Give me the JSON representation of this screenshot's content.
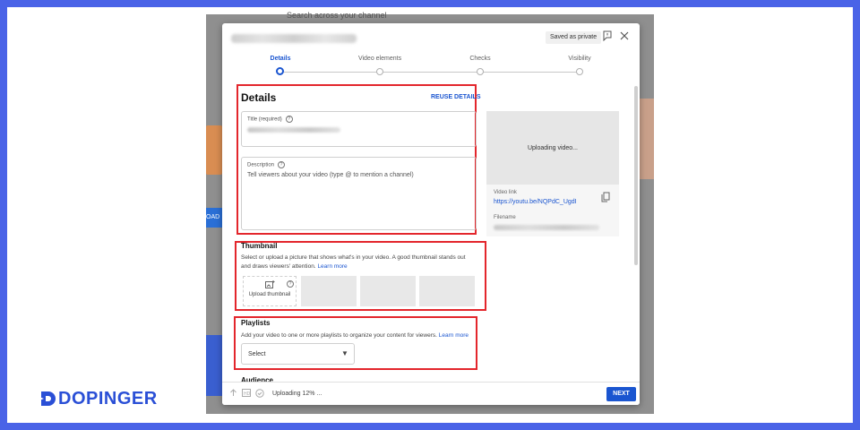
{
  "background_screen": {
    "search_placeholder": "Search across your channel",
    "left_fragment_load": "OAD"
  },
  "dialog": {
    "header": {
      "saved_badge": "Saved as private",
      "feedback_icon": "feedback-icon",
      "close_icon": "close-icon"
    },
    "stepper": [
      {
        "label": "Details",
        "active": true
      },
      {
        "label": "Video elements",
        "active": false
      },
      {
        "label": "Checks",
        "active": false
      },
      {
        "label": "Visibility",
        "active": false
      }
    ],
    "details": {
      "title": "Details",
      "reuse_label": "REUSE DETAILS",
      "title_field_label": "Title (required)",
      "description_label": "Description",
      "description_placeholder": "Tell viewers about your video (type @ to mention a channel)"
    },
    "upload_card": {
      "status": "Uploading video...",
      "video_link_label": "Video link",
      "video_link": "https://youtu.be/NQPdC_UgdI",
      "filename_label": "Filename"
    },
    "thumbnail": {
      "title": "Thumbnail",
      "text": "Select or upload a picture that shows what's in your video. A good thumbnail stands out and draws viewers' attention.",
      "learn_more": "Learn more",
      "upload_label": "Upload thumbnail"
    },
    "playlists": {
      "title": "Playlists",
      "text": "Add your video to one or more playlists to organize your content for viewers.",
      "learn_more": "Learn more",
      "select_value": "Select"
    },
    "audience_title": "Audience",
    "footer": {
      "status": "Uploading 12% ...",
      "next_label": "NEXT"
    }
  },
  "colors": {
    "accent": "#1a55d0",
    "highlight_box": "#e3262c",
    "frame_bg": "#4a63e7",
    "logo": "#2a4fd6"
  },
  "logo": {
    "text": "DOPINGER"
  }
}
